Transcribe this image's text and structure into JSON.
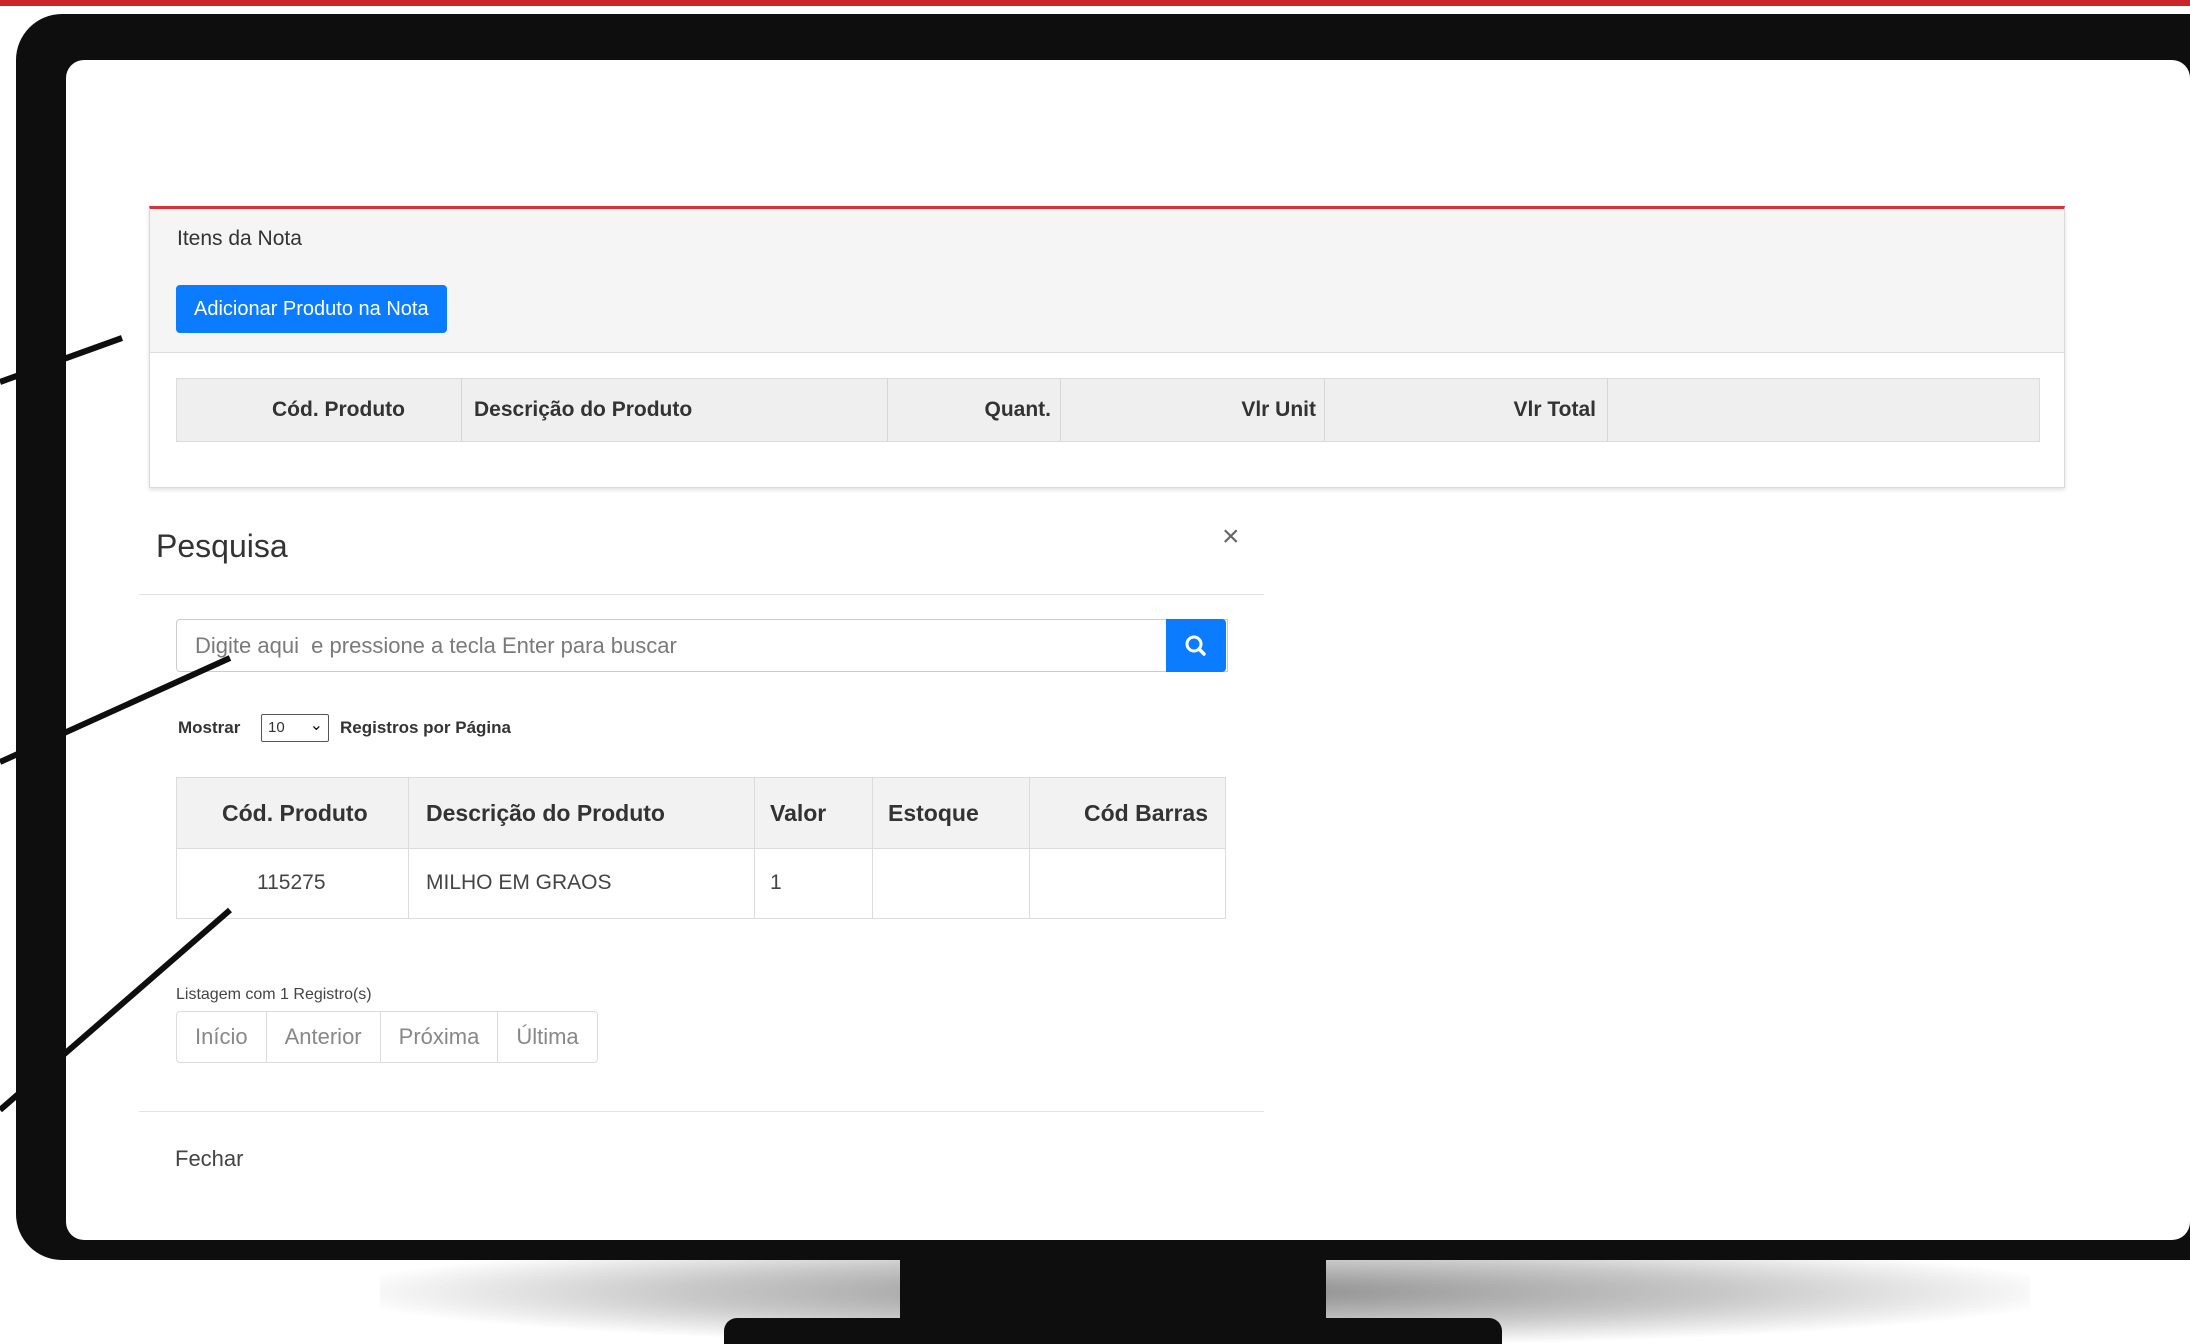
{
  "card": {
    "title": "Itens da Nota",
    "add_button": "Adicionar Produto na Nota",
    "columns": [
      "Cód. Produto",
      "Descrição do Produto",
      "Quant.",
      "Vlr Unit",
      "Vlr Total"
    ]
  },
  "modal": {
    "title": "Pesquisa",
    "close_symbol": "×",
    "search_placeholder": "Digite aqui  e pressione a tecla Enter para buscar",
    "show_label": "Mostrar",
    "per_page_value": "10",
    "per_page_suffix": "Registros por Página",
    "table": {
      "columns": [
        "Cód. Produto",
        "Descrição do Produto",
        "Valor",
        "Estoque",
        "Cód Barras"
      ],
      "rows": [
        [
          "115275",
          "MILHO EM GRAOS",
          "1",
          "",
          ""
        ]
      ]
    },
    "listing_text": "Listagem com 1 Registro(s)",
    "pagination": [
      "Início",
      "Anterior",
      "Próxima",
      "Última"
    ],
    "close_button": "Fechar"
  },
  "colors": {
    "accent_red": "#d9313a",
    "primary_blue": "#0b7bff",
    "bezel": "#0e0e0e"
  }
}
